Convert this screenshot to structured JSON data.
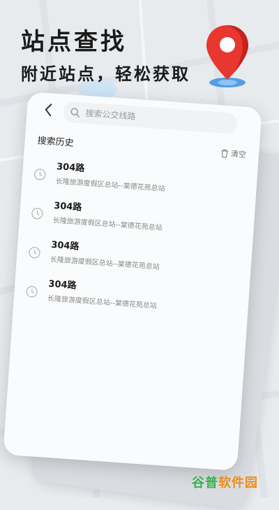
{
  "hero": {
    "title": "站点查找",
    "subtitle": "附近站点，轻松获取"
  },
  "icons": {
    "pin": "location-pin-icon",
    "back": "chevron-left-icon",
    "search": "search-icon",
    "trash": "trash-icon",
    "clock": "clock-icon"
  },
  "colors": {
    "pin_red": "#e8372f",
    "accent_green": "#3bb04a",
    "accent_orange": "#f08c1a"
  },
  "search": {
    "placeholder": "搜索公交线路"
  },
  "history": {
    "title": "搜索历史",
    "clear_label": "清空",
    "items": [
      {
        "route": "304路",
        "desc": "长隆旅游度假区总站--棠德花苑总站"
      },
      {
        "route": "304路",
        "desc": "长隆旅游度假区总站--棠德花苑总站"
      },
      {
        "route": "304路",
        "desc": "长隆旅游度假区总站--棠德花苑总站"
      },
      {
        "route": "304路",
        "desc": "长隆旅游度假区总站--棠德花苑总站"
      }
    ]
  },
  "watermark": {
    "part1": "谷普",
    "part2": "软件园"
  }
}
